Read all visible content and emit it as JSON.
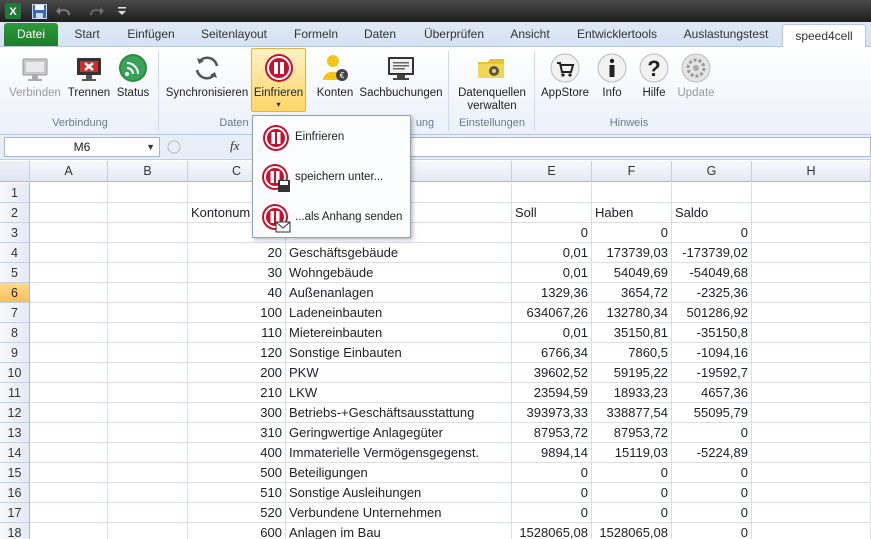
{
  "tabs": {
    "file": "Datei",
    "items": [
      "Start",
      "Einfügen",
      "Seitenlayout",
      "Formeln",
      "Daten",
      "Überprüfen",
      "Ansicht",
      "Entwicklertools",
      "Auslastungstest"
    ],
    "active": "speed4cell"
  },
  "ribbon": {
    "buttons": {
      "connect": "Verbinden",
      "disconnect": "Trennen",
      "status": "Status",
      "sync": "Synchronisieren",
      "freeze": "Einfrieren",
      "accounts": "Konten",
      "bookings": "Sachbuchungen",
      "datasources_l1": "Datenquellen",
      "datasources_l2": "verwalten",
      "appstore": "AppStore",
      "info": "Info",
      "help": "Hilfe",
      "update": "Update"
    },
    "groups": {
      "connection": "Verbindung",
      "data": "Daten",
      "booking": "ung",
      "settings": "Einstellungen",
      "hint": "Hinweis"
    }
  },
  "dropdown": {
    "items": [
      "Einfrieren",
      "speichern unter...",
      "...als Anhang senden"
    ]
  },
  "formula_bar": {
    "name_box": "M6",
    "fx": "fx",
    "value": ""
  },
  "grid": {
    "columns": [
      "A",
      "B",
      "C",
      "D",
      "E",
      "F",
      "G",
      "H"
    ],
    "selected_row": "6",
    "rows": [
      {
        "n": "1",
        "c": "",
        "d": "",
        "e": "",
        "f": "",
        "g": ""
      },
      {
        "n": "2",
        "c": "Kontonum",
        "d": "",
        "e": "Soll",
        "f": "Haben",
        "g": "Saldo"
      },
      {
        "n": "3",
        "c": "",
        "d": "",
        "e": "0",
        "f": "0",
        "g": "0"
      },
      {
        "n": "4",
        "c": "20",
        "d": "Geschäftsgebäude",
        "e": "0,01",
        "f": "173739,03",
        "g": "-173739,02"
      },
      {
        "n": "5",
        "c": "30",
        "d": "Wohngebäude",
        "e": "0,01",
        "f": "54049,69",
        "g": "-54049,68"
      },
      {
        "n": "6",
        "c": "40",
        "d": "Außenanlagen",
        "e": "1329,36",
        "f": "3654,72",
        "g": "-2325,36"
      },
      {
        "n": "7",
        "c": "100",
        "d": "Ladeneinbauten",
        "e": "634067,26",
        "f": "132780,34",
        "g": "501286,92"
      },
      {
        "n": "8",
        "c": "110",
        "d": "Mietereinbauten",
        "e": "0,01",
        "f": "35150,81",
        "g": "-35150,8"
      },
      {
        "n": "9",
        "c": "120",
        "d": "Sonstige Einbauten",
        "e": "6766,34",
        "f": "7860,5",
        "g": "-1094,16"
      },
      {
        "n": "10",
        "c": "200",
        "d": "PKW",
        "e": "39602,52",
        "f": "59195,22",
        "g": "-19592,7"
      },
      {
        "n": "11",
        "c": "210",
        "d": "LKW",
        "e": "23594,59",
        "f": "18933,23",
        "g": "4657,36"
      },
      {
        "n": "12",
        "c": "300",
        "d": "Betriebs-+Geschäftsausstattung",
        "e": "393973,33",
        "f": "338877,54",
        "g": "55095,79"
      },
      {
        "n": "13",
        "c": "310",
        "d": "Geringwertige Anlagegüter",
        "e": "87953,72",
        "f": "87953,72",
        "g": "0"
      },
      {
        "n": "14",
        "c": "400",
        "d": "Immaterielle Vermögensgegenst.",
        "e": "9894,14",
        "f": "15119,03",
        "g": "-5224,89"
      },
      {
        "n": "15",
        "c": "500",
        "d": "Beteiligungen",
        "e": "0",
        "f": "0",
        "g": "0"
      },
      {
        "n": "16",
        "c": "510",
        "d": "Sonstige Ausleihungen",
        "e": "0",
        "f": "0",
        "g": "0"
      },
      {
        "n": "17",
        "c": "520",
        "d": "Verbundene Unternehmen",
        "e": "0",
        "f": "0",
        "g": "0"
      },
      {
        "n": "18",
        "c": "600",
        "d": "Anlagen im Bau",
        "e": "1528065,08",
        "f": "1528065,08",
        "g": "0"
      }
    ]
  },
  "colors": {
    "file_tab": "#1d7d2a",
    "freeze_button": "#ffd667",
    "selected_row_header": "#f9c059",
    "stop_red": "#c8102e"
  }
}
